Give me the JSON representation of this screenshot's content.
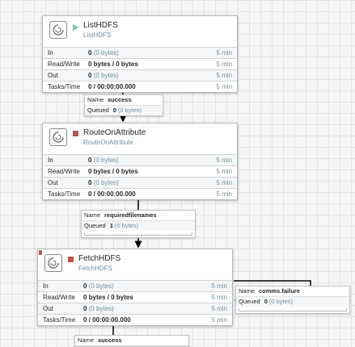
{
  "processors": [
    {
      "name": "ListHDFS",
      "type": "ListHDFS",
      "status_icon": "play-icon",
      "invalid": false,
      "stats": [
        {
          "label": "In",
          "value": "0",
          "detail": "(0 bytes)",
          "window": "5 min"
        },
        {
          "label": "Read/Write",
          "value": "0 bytes / 0 bytes",
          "detail": "",
          "window": "5 min"
        },
        {
          "label": "Out",
          "value": "0",
          "detail": "(0 bytes)",
          "window": "5 min"
        },
        {
          "label": "Tasks/Time",
          "value": "0 / 00:00:00.000",
          "detail": "",
          "window": "5 min"
        }
      ]
    },
    {
      "name": "RouteOnAttribute",
      "type": "RouteOnAttribute",
      "status_icon": "stop-icon",
      "invalid": false,
      "stats": [
        {
          "label": "In",
          "value": "0",
          "detail": "(0 bytes)",
          "window": "5 min"
        },
        {
          "label": "Read/Write",
          "value": "0 bytes / 0 bytes",
          "detail": "",
          "window": "5 min"
        },
        {
          "label": "Out",
          "value": "0",
          "detail": "(0 bytes)",
          "window": "5 min"
        },
        {
          "label": "Tasks/Time",
          "value": "0 / 00:00:00.000",
          "detail": "",
          "window": "5 min"
        }
      ]
    },
    {
      "name": "FetchHDFS",
      "type": "FetchHDFS",
      "status_icon": "stop-icon",
      "invalid": true,
      "stats": [
        {
          "label": "In",
          "value": "0",
          "detail": "(0 bytes)",
          "window": "5 min"
        },
        {
          "label": "Read/Write",
          "value": "0 bytes / 0 bytes",
          "detail": "",
          "window": "5 min"
        },
        {
          "label": "Out",
          "value": "0",
          "detail": "(0 bytes)",
          "window": "5 min"
        },
        {
          "label": "Tasks/Time",
          "value": "0 / 00:00:00.000",
          "detail": "",
          "window": "5 min"
        }
      ]
    }
  ],
  "connections": [
    {
      "name_label": "Name",
      "name": "success",
      "queued_label": "Queued",
      "queued": "0",
      "queued_bytes": "(0 bytes)"
    },
    {
      "name_label": "Name",
      "name": "requiredfilenames",
      "queued_label": "Queued",
      "queued": "1",
      "queued_bytes": "(0 bytes)"
    },
    {
      "name_label": "Name",
      "name": "comms.failure",
      "queued_label": "Queued",
      "queued": "0",
      "queued_bytes": "(0 bytes)"
    },
    {
      "name_label": "Name",
      "name": "success",
      "queued_label": "",
      "queued": "",
      "queued_bytes": ""
    }
  ],
  "colors": {
    "running": "#7dc7a0",
    "stopped": "#ba554a",
    "canvas_grid": "#e4e4e4",
    "edge": "#000000"
  }
}
